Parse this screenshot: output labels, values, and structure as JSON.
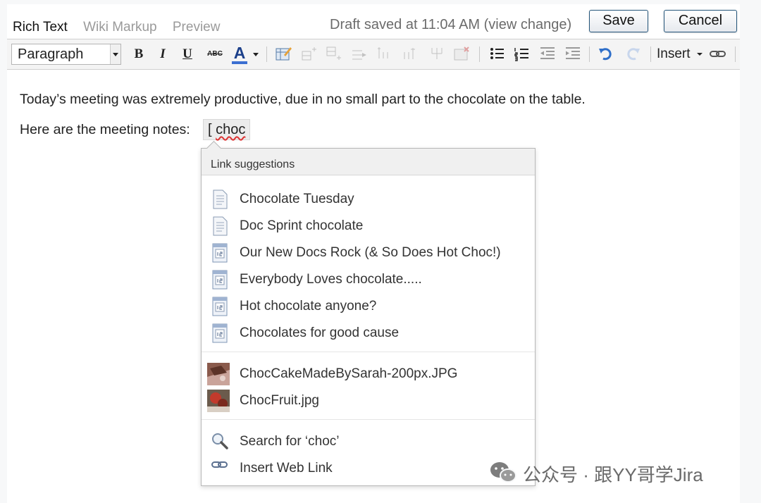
{
  "tabs": [
    {
      "label": "Rich Text",
      "active": true
    },
    {
      "label": "Wiki Markup",
      "active": false
    },
    {
      "label": "Preview",
      "active": false
    }
  ],
  "draft_status": "Draft saved at 11:04 AM (view change)",
  "buttons": {
    "save": "Save",
    "cancel": "Cancel"
  },
  "toolbar": {
    "paragraph_style": "Paragraph",
    "bold": "B",
    "italic": "I",
    "underline": "U",
    "strikethrough": "ABC",
    "font_color": "A",
    "insert_menu": "Insert",
    "icons": [
      "bold-icon",
      "italic-icon",
      "underline-icon",
      "strikethrough-icon",
      "font-color-icon",
      "insert-table-icon",
      "insert-row-before-icon",
      "insert-row-after-icon",
      "insert-column-icon",
      "delete-column-icon",
      "merge-cells-icon",
      "split-cells-icon",
      "delete-table-icon",
      "bullet-list-icon",
      "numbered-list-icon",
      "outdent-icon",
      "indent-icon",
      "undo-icon",
      "redo-icon",
      "link-icon"
    ]
  },
  "content": {
    "line1": "Today’s meeting was extremely productive, due in no small part to the chocolate on the table.",
    "line2": "Here are the meeting notes:",
    "typed_bracket": "[",
    "typed_word": "choc"
  },
  "suggestions": {
    "header": "Link suggestions",
    "pages": [
      {
        "label": "Chocolate Tuesday",
        "icon": "page-icon"
      },
      {
        "label": "Doc Sprint chocolate",
        "icon": "page-icon"
      },
      {
        "label": "Our New Docs Rock (& So Does Hot Choc!)",
        "icon": "blog-post-icon"
      },
      {
        "label": "Everybody Loves chocolate.....",
        "icon": "blog-post-icon"
      },
      {
        "label": "Hot chocolate anyone?",
        "icon": "blog-post-icon"
      },
      {
        "label": "Chocolates for good cause",
        "icon": "blog-post-icon"
      }
    ],
    "attachments": [
      {
        "label": "ChocCakeMadeBySarah-200px.JPG",
        "icon": "image-thumbnail-icon"
      },
      {
        "label": "ChocFruit.jpg",
        "icon": "image-thumbnail-icon"
      }
    ],
    "actions": [
      {
        "label": "Search for ‘choc’",
        "icon": "search-icon"
      },
      {
        "label": "Insert Web Link",
        "icon": "link-icon"
      }
    ]
  },
  "watermark": "公众号 · 跟YY哥学Jira",
  "colors": {
    "button_border": "#24557a",
    "font_color_bar": "#3c6fd1",
    "undo_blue": "#2f6fc9"
  }
}
